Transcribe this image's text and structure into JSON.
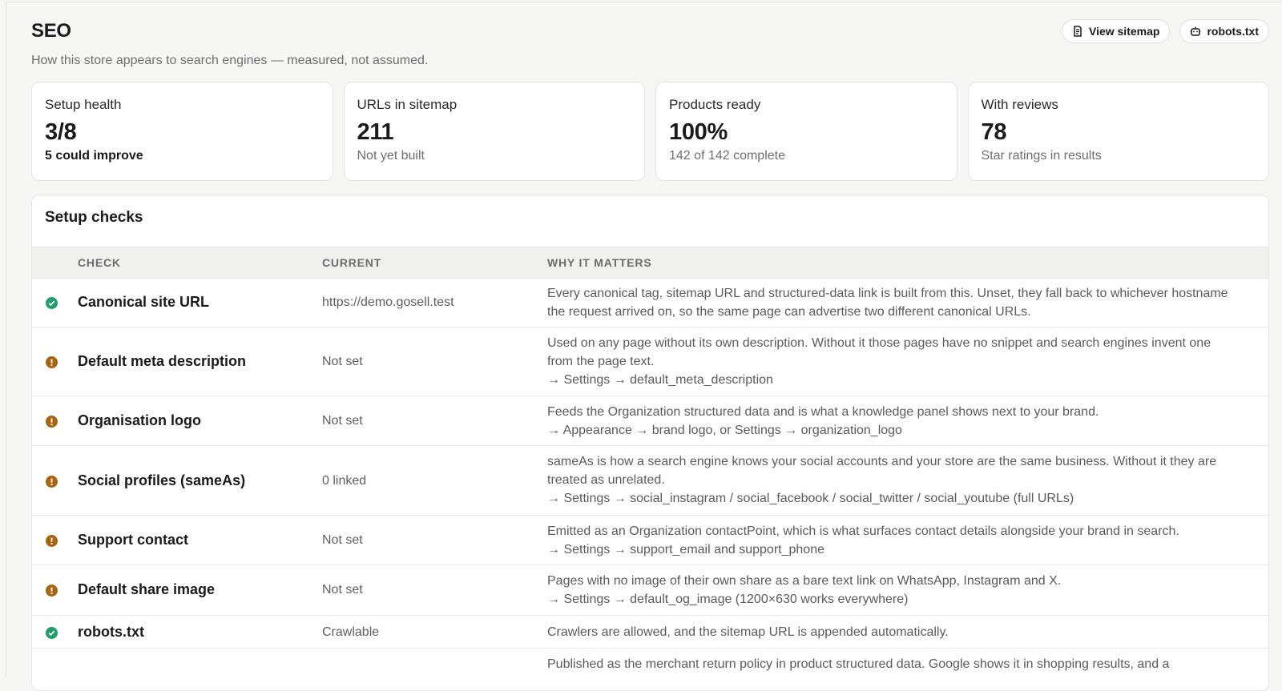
{
  "header": {
    "title": "SEO",
    "subtitle": "How this store appears to search engines — measured, not assumed.",
    "actions": [
      {
        "label": "View sitemap",
        "icon": "document-icon"
      },
      {
        "label": "robots.txt",
        "icon": "robot-icon"
      }
    ]
  },
  "stats": [
    {
      "label": "Setup health",
      "value": "3/8",
      "sub": "5 could improve"
    },
    {
      "label": "URLs in sitemap",
      "value": "211",
      "sub": "Not yet built"
    },
    {
      "label": "Products ready",
      "value": "100%",
      "sub": "142 of 142 complete"
    },
    {
      "label": "With reviews",
      "value": "78",
      "sub": "Star ratings in results"
    }
  ],
  "checks": {
    "title": "Setup checks",
    "columns": [
      "CHECK",
      "CURRENT",
      "WHY IT MATTERS"
    ],
    "rows": [
      {
        "status": "ok",
        "name": "Canonical site URL",
        "current": "https://demo.gosell.test",
        "why": "Every canonical tag, sitemap URL and structured-data link is built from this. Unset, they fall back to whichever hostname the request arrived on, so the same page can advertise two different canonical URLs.",
        "hint": ""
      },
      {
        "status": "warn",
        "name": "Default meta description",
        "current": "Not set",
        "why": "Used on any page without its own description. Without it those pages have no snippet and search engines invent one from the page text.",
        "hint": "→ Settings → default_meta_description"
      },
      {
        "status": "warn",
        "name": "Organisation logo",
        "current": "Not set",
        "why": "Feeds the Organization structured data and is what a knowledge panel shows next to your brand.",
        "hint": "→ Appearance → brand logo, or Settings → organization_logo"
      },
      {
        "status": "warn",
        "name": "Social profiles (sameAs)",
        "current": "0 linked",
        "why": "sameAs is how a search engine knows your social accounts and your store are the same business. Without it they are treated as unrelated.",
        "hint": "→ Settings → social_instagram / social_facebook / social_twitter / social_youtube (full URLs)"
      },
      {
        "status": "warn",
        "name": "Support contact",
        "current": "Not set",
        "why": "Emitted as an Organization contactPoint, which is what surfaces contact details alongside your brand in search.",
        "hint": "→ Settings → support_email and support_phone"
      },
      {
        "status": "warn",
        "name": "Default share image",
        "current": "Not set",
        "why": "Pages with no image of their own share as a bare text link on WhatsApp, Instagram and X.",
        "hint": "→ Settings → default_og_image (1200×630 works everywhere)"
      },
      {
        "status": "ok",
        "name": "robots.txt",
        "current": "Crawlable",
        "why": "Crawlers are allowed, and the sitemap URL is appended automatically.",
        "hint": ""
      },
      {
        "status": "",
        "name": "",
        "current": "",
        "why": "Published as the merchant return policy in product structured data. Google shows it in shopping results, and a",
        "hint": ""
      }
    ]
  }
}
